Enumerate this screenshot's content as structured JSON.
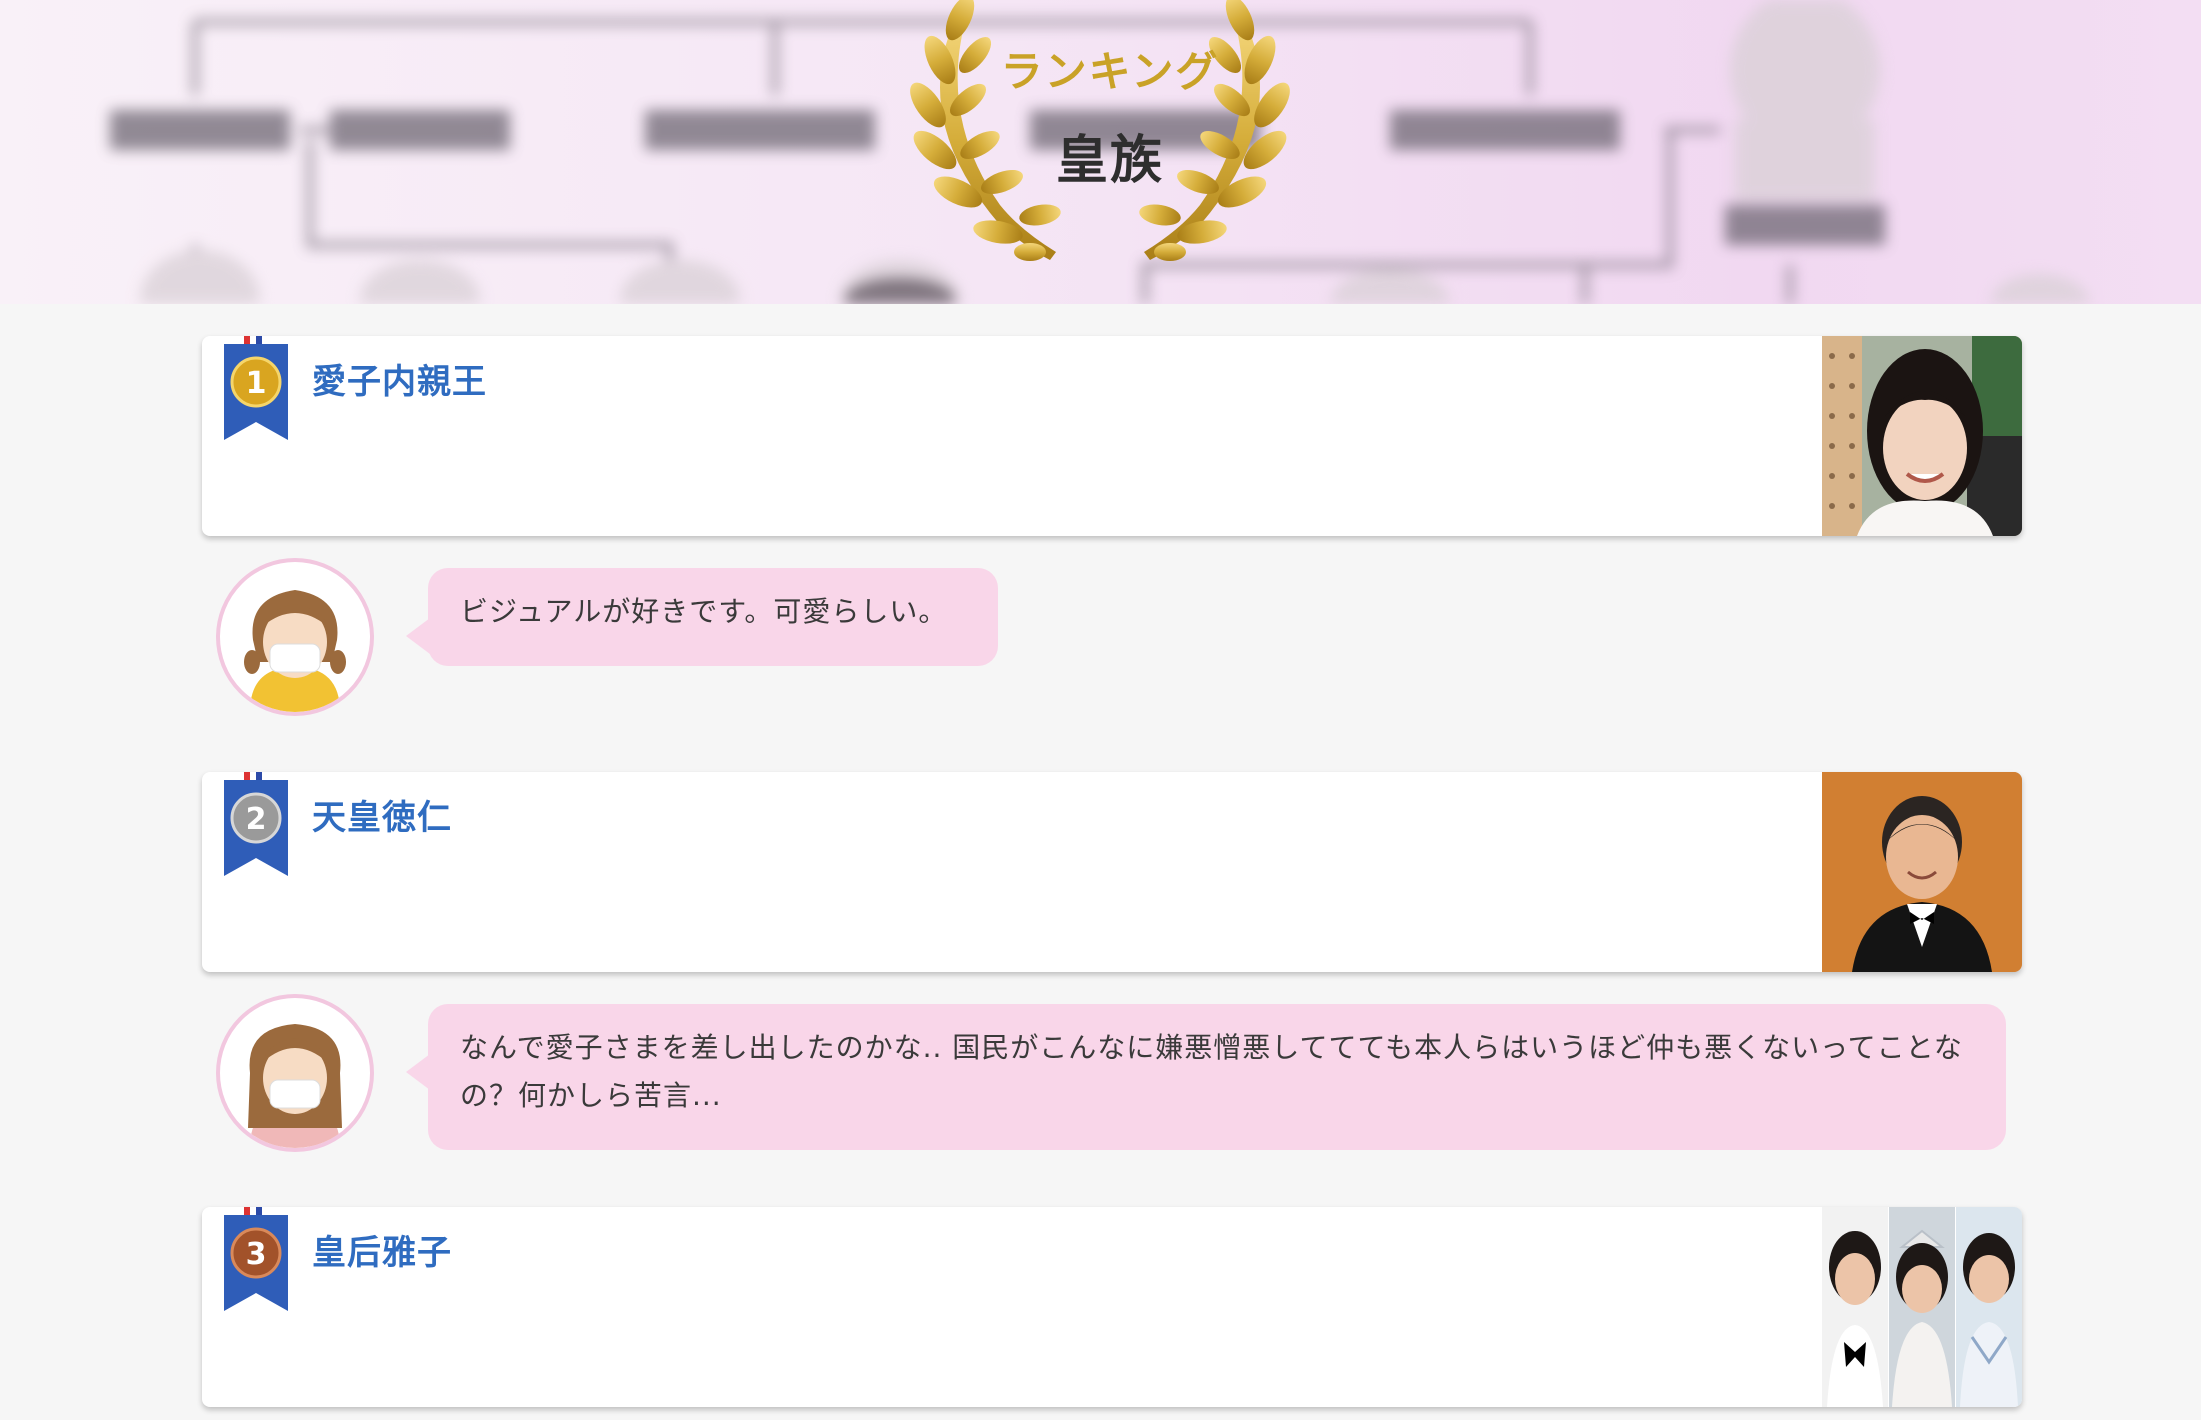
{
  "header": {
    "ranking_label": "ランキング",
    "category_title": "皇族"
  },
  "rankings": [
    {
      "rank": "1",
      "name": "愛子内親王",
      "medal_color": "#d9a520"
    },
    {
      "rank": "2",
      "name": "天皇徳仁",
      "medal_color": "#9a9a9a"
    },
    {
      "rank": "3",
      "name": "皇后雅子",
      "medal_color": "#a2522a"
    }
  ],
  "comments": [
    {
      "text": "ビジュアルが好きです。可愛らしい。",
      "shirt_color": "#f2c233"
    },
    {
      "text": "なんで愛子さまを差し出したのかな.. 国民がこんなに嫌悪憎悪しててても本人らはいうほど仲も悪くないってことなの？何かしら苦言...",
      "shirt_color": "#f0b8b8"
    }
  ],
  "colors": {
    "name_link": "#2f6cc0",
    "bubble": "#f9d6e9",
    "avatar_border": "#f2c7df",
    "gold": "#c9a227"
  }
}
